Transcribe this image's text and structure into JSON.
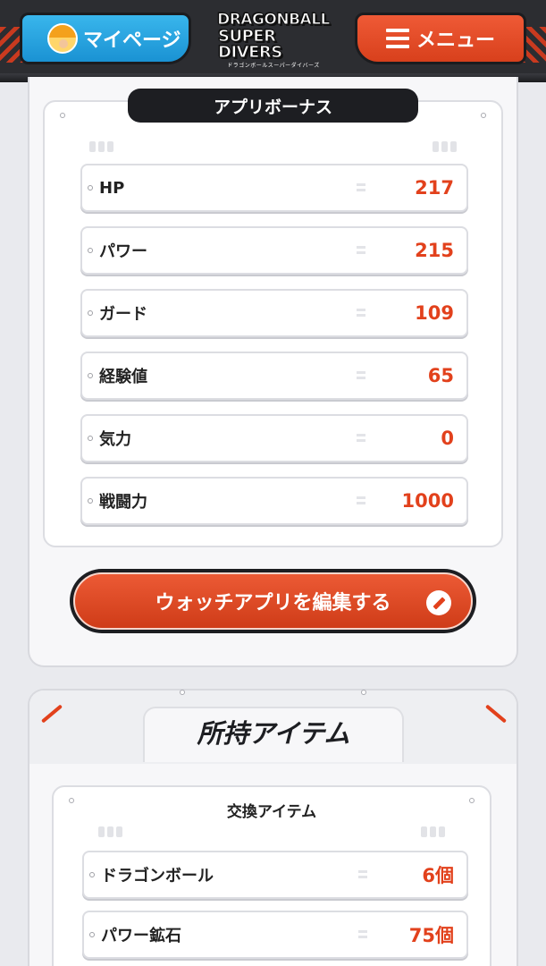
{
  "header": {
    "mypage_label": "マイページ",
    "menu_label": "メニュー",
    "logo": {
      "line1": "DRAGONBALL",
      "line2": "SUPER DIVERS",
      "sub": "ドラゴンボールスーパーダイバーズ"
    }
  },
  "app_bonus": {
    "title": "アプリボーナス",
    "rows": [
      {
        "label": "HP",
        "value": "217"
      },
      {
        "label": "パワー",
        "value": "215"
      },
      {
        "label": "ガード",
        "value": "109"
      },
      {
        "label": "経験値",
        "value": "65"
      },
      {
        "label": "気力",
        "value": "0"
      },
      {
        "label": "戦闘力",
        "value": "1000"
      }
    ],
    "edit_button_label": "ウォッチアプリを編集する"
  },
  "items": {
    "title": "所持アイテム",
    "subsection_title": "交換アイテム",
    "rows": [
      {
        "label": "ドラゴンボール",
        "value": "6個"
      },
      {
        "label": "パワー鉱石",
        "value": "75個"
      }
    ]
  },
  "colors": {
    "accent_red": "#e2411c",
    "mypage_blue": "#1a92d3",
    "dark": "#1d1e22"
  }
}
